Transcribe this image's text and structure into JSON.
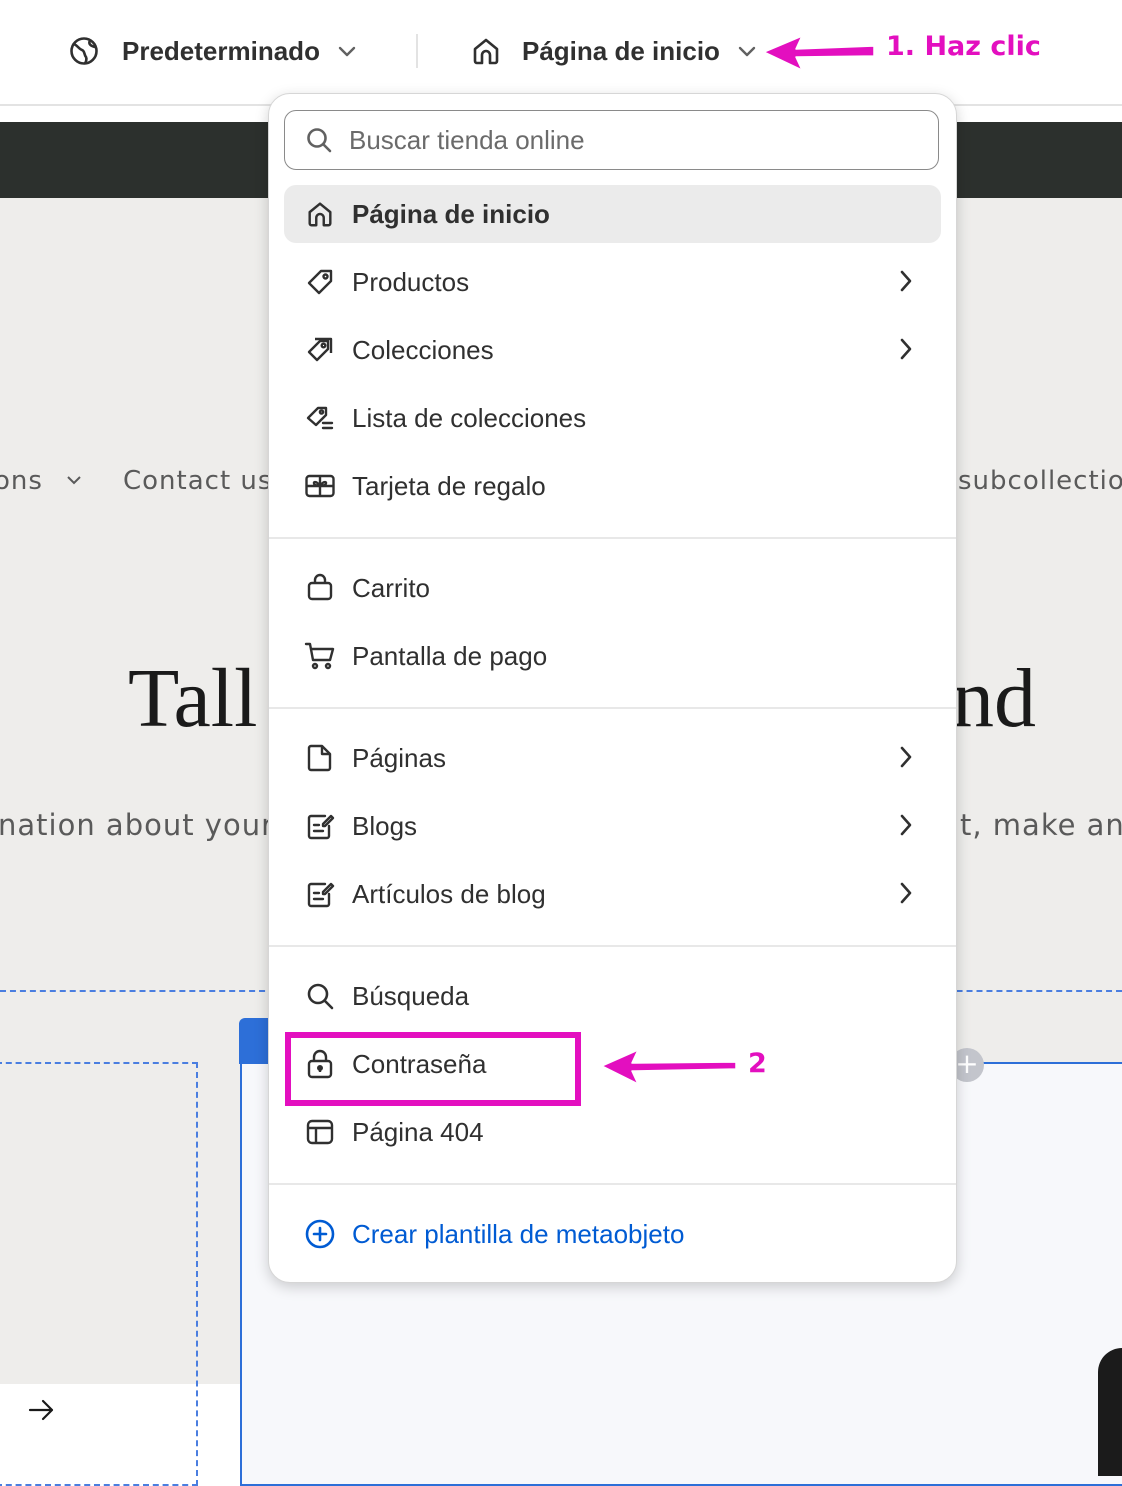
{
  "topbar": {
    "theme_label": "Predeterminado",
    "page_label": "Página de inicio"
  },
  "preview": {
    "nav_left": "ons",
    "nav_contact": "Contact us",
    "nav_right": "subcollection",
    "hero_left": "Tall",
    "hero_right": "nd",
    "hero_sub_left": "nation about your",
    "hero_sub_right": "t, make ann"
  },
  "dropdown": {
    "search_placeholder": "Buscar tienda online",
    "groups": [
      [
        {
          "label": "Página de inicio",
          "icon": "home-icon",
          "selected": true
        },
        {
          "label": "Productos",
          "icon": "tag-icon",
          "submenu": true
        },
        {
          "label": "Colecciones",
          "icon": "tags-icon",
          "submenu": true
        },
        {
          "label": "Lista de colecciones",
          "icon": "collection-list-icon"
        },
        {
          "label": "Tarjeta de regalo",
          "icon": "gift-card-icon"
        }
      ],
      [
        {
          "label": "Carrito",
          "icon": "bag-icon"
        },
        {
          "label": "Pantalla de pago",
          "icon": "cart-icon"
        }
      ],
      [
        {
          "label": "Páginas",
          "icon": "page-icon",
          "submenu": true
        },
        {
          "label": "Blogs",
          "icon": "blog-icon",
          "submenu": true
        },
        {
          "label": "Artículos de blog",
          "icon": "blog-post-icon",
          "submenu": true
        }
      ],
      [
        {
          "label": "Búsqueda",
          "icon": "search-icon"
        },
        {
          "label": "Contraseña",
          "icon": "lock-icon"
        },
        {
          "label": "Página 404",
          "icon": "not-found-page-icon"
        }
      ]
    ],
    "create_label": "Crear plantilla de metaobjeto"
  },
  "annotations": {
    "step1": "1. Haz clic",
    "step2": "2",
    "color": "#e30fbf"
  },
  "colors": {
    "link_blue": "#005bd3",
    "selection_blue": "#2d6fd8",
    "announcement_bar": "#2c302d"
  }
}
